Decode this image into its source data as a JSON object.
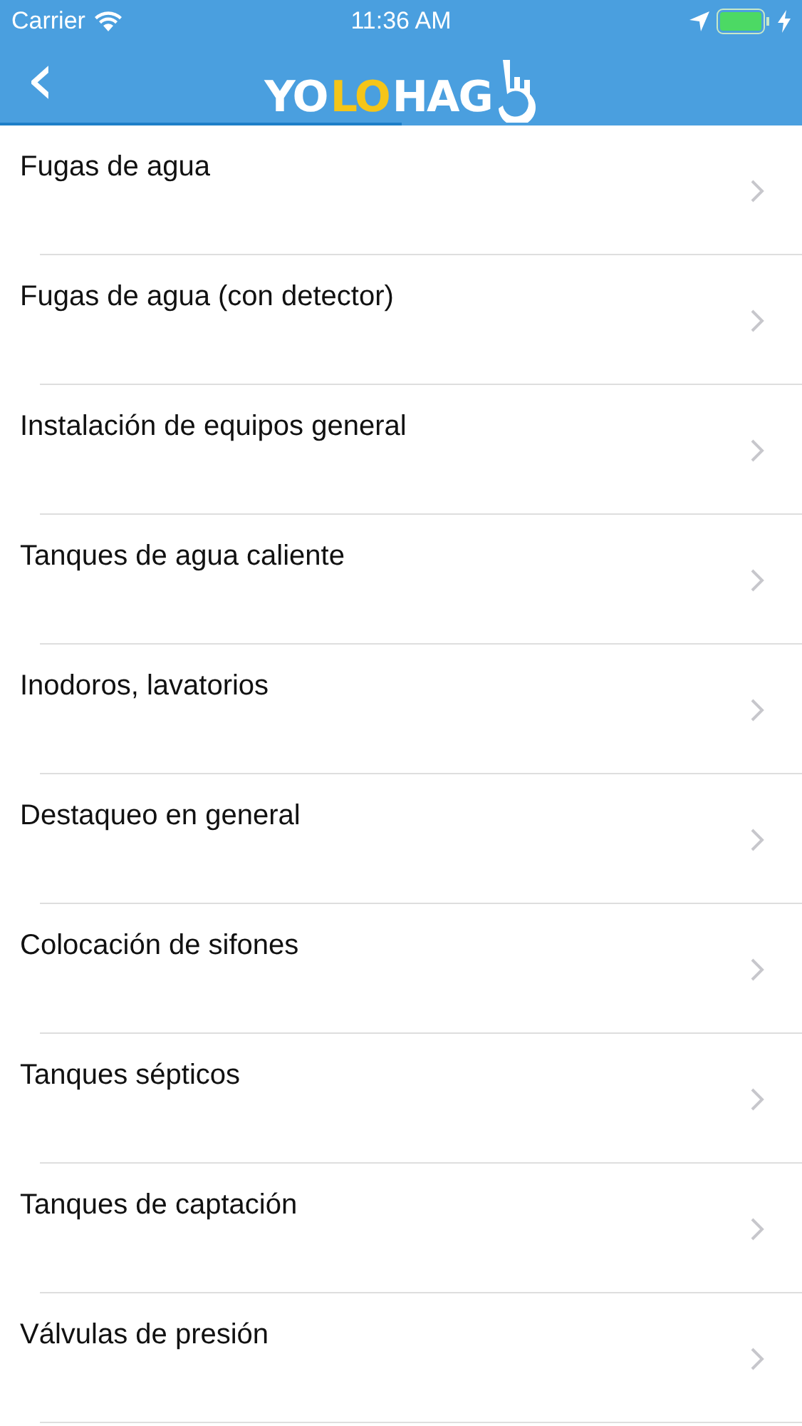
{
  "status_bar": {
    "carrier": "Carrier",
    "time": "11:36 AM",
    "charging": true
  },
  "nav": {
    "back": "‹",
    "logo": [
      {
        "text": "YO",
        "color": "#ffffff"
      },
      {
        "text": "LO",
        "color": "#f5c518"
      },
      {
        "text": "HAG",
        "color": "#ffffff"
      }
    ],
    "loading": {
      "level": 0.5
    }
  },
  "items": [
    {
      "label": "Fugas de agua"
    },
    {
      "label": "Fugas de agua (con detector)"
    },
    {
      "label": "Instalación de equipos general"
    },
    {
      "label": "Tanques de agua caliente"
    },
    {
      "label": "Inodoros, lavatorios"
    },
    {
      "label": "Destaqueo en general"
    },
    {
      "label": "Colocación de sifones"
    },
    {
      "label": "Tanques sépticos"
    },
    {
      "label": "Tanques de captación"
    },
    {
      "label": "Válvulas de presión"
    }
  ]
}
